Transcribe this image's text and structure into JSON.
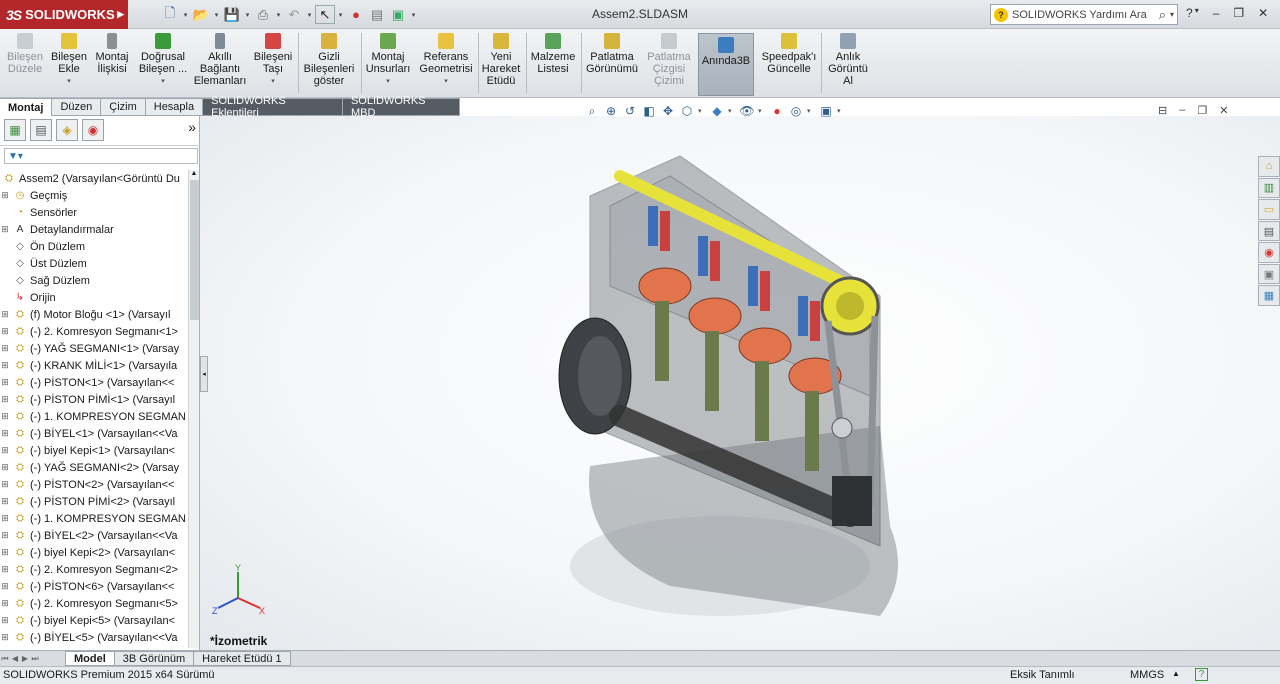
{
  "app": {
    "brand": "SOLIDWORKS",
    "brand_ds": "3S",
    "document_title": "Assem2.SLDASM"
  },
  "quick_access": {
    "icons": [
      "new-icon",
      "open-icon",
      "save-icon",
      "print-icon",
      "undo-icon",
      "select-icon",
      "rebuild-icon",
      "file-properties-icon",
      "options-icon"
    ]
  },
  "search": {
    "placeholder": "SOLIDWORKS Yardımı'n Ara",
    "display": "SOLIDWORKS Yardımı Ara"
  },
  "window": {
    "help": "?",
    "min": "–",
    "restore": "❐",
    "close": "✕"
  },
  "commands": [
    {
      "l1": "Bileşen",
      "l2": "Düzele",
      "l3": "",
      "disabled": true
    },
    {
      "l1": "Bileşen",
      "l2": "Ekle",
      "l3": ""
    },
    {
      "l1": "Montaj",
      "l2": "İlişkisi",
      "l3": ""
    },
    {
      "l1": "Doğrusal",
      "l2": "Bileşen ...",
      "l3": ""
    },
    {
      "l1": "Akıllı",
      "l2": "Bağlantı",
      "l3": "Elemanları"
    },
    {
      "l1": "Bileşeni",
      "l2": "Taşı",
      "l3": ""
    },
    {
      "l1": "Gizli",
      "l2": "Bileşenleri",
      "l3": "göster"
    },
    {
      "l1": "Montaj",
      "l2": "Unsurları",
      "l3": ""
    },
    {
      "l1": "Referans",
      "l2": "Geometrisi",
      "l3": ""
    },
    {
      "l1": "Yeni",
      "l2": "Hareket",
      "l3": "Etüdü"
    },
    {
      "l1": "Malzeme",
      "l2": "Listesi",
      "l3": ""
    },
    {
      "l1": "Patlatma",
      "l2": "Görünümü",
      "l3": ""
    },
    {
      "l1": "Patlatma",
      "l2": "Çizgisi",
      "l3": "Çizimi",
      "disabled": true
    },
    {
      "l1": "Anında3B",
      "l2": "",
      "l3": ""
    },
    {
      "l1": "Speedpak'ı",
      "l2": "Güncelle",
      "l3": ""
    },
    {
      "l1": "Anlık",
      "l2": "Görüntü",
      "l3": "Al"
    }
  ],
  "tabs": [
    "Montaj",
    "Düzen",
    "Çizim",
    "Hesapla",
    "SOLIDWORKS Eklentileri",
    "SOLIDWORKS MBD"
  ],
  "tree": {
    "root": "Assem2  (Varsayılan<Görüntü Du",
    "items": [
      {
        "label": "Geçmiş",
        "icon": "history-icon"
      },
      {
        "label": "Sensörler",
        "icon": "sensor-icon"
      },
      {
        "label": "Detaylandırmalar",
        "icon": "annotations-icon"
      },
      {
        "label": "Ön Düzlem",
        "icon": "plane-icon"
      },
      {
        "label": "Üst Düzlem",
        "icon": "plane-icon"
      },
      {
        "label": "Sağ Düzlem",
        "icon": "plane-icon"
      },
      {
        "label": "Orijin",
        "icon": "origin-icon"
      },
      {
        "label": "(f) Motor Bloğu <1> (Varsayıl",
        "icon": "part-icon"
      },
      {
        "label": "(-) 2. Komresyon Segmanı<1>",
        "icon": "part-icon"
      },
      {
        "label": "(-) YAĞ SEGMANI<1> (Varsay",
        "icon": "part-icon"
      },
      {
        "label": "(-) KRANK MİLİ<1> (Varsayıla",
        "icon": "part-icon"
      },
      {
        "label": "(-) PİSTON<1> (Varsayılan<<",
        "icon": "part-icon"
      },
      {
        "label": "(-) PİSTON PİMİ<1> (Varsayıl",
        "icon": "part-icon"
      },
      {
        "label": "(-) 1. KOMPRESYON SEGMAN",
        "icon": "part-icon"
      },
      {
        "label": "(-) BİYEL<1> (Varsayılan<<Va",
        "icon": "part-icon"
      },
      {
        "label": "(-) biyel Kepi<1> (Varsayılan<",
        "icon": "part-icon"
      },
      {
        "label": "(-) YAĞ SEGMANI<2> (Varsay",
        "icon": "part-icon"
      },
      {
        "label": "(-) PİSTON<2> (Varsayılan<<",
        "icon": "part-icon"
      },
      {
        "label": "(-) PİSTON PİMİ<2> (Varsayıl",
        "icon": "part-icon"
      },
      {
        "label": "(-) 1. KOMPRESYON SEGMAN",
        "icon": "part-icon"
      },
      {
        "label": "(-) BİYEL<2> (Varsayılan<<Va",
        "icon": "part-icon"
      },
      {
        "label": "(-) biyel Kepi<2> (Varsayılan<",
        "icon": "part-icon"
      },
      {
        "label": "(-) 2. Komresyon Segmanı<2>",
        "icon": "part-icon"
      },
      {
        "label": "(-) PİSTON<6> (Varsayılan<<",
        "icon": "part-icon"
      },
      {
        "label": "(-) 2. Komresyon Segmanı<5>",
        "icon": "part-icon"
      },
      {
        "label": "(-) biyel Kepi<5> (Varsayılan<",
        "icon": "part-icon"
      },
      {
        "label": "(-) BİYEL<5> (Varsayılan<<Va",
        "icon": "part-icon"
      }
    ]
  },
  "viewport": {
    "orientation_label": "*İzometrik",
    "axes": {
      "x": "X",
      "y": "Y",
      "z": "Z"
    }
  },
  "bottom_tabs": [
    "Model",
    "3B Görünüm",
    "Hareket Etüdü 1"
  ],
  "status": {
    "left": "SOLIDWORKS Premium 2015 x64 Sürümü",
    "edit": "Eksik Tanımlı",
    "units": "MMGS",
    "units_arrow": "▲",
    "help": "?"
  },
  "colors": {
    "brand": "#b3272b",
    "piston": "#e2744d",
    "camshaft": "#e7e23a",
    "block": "#6e7378"
  }
}
